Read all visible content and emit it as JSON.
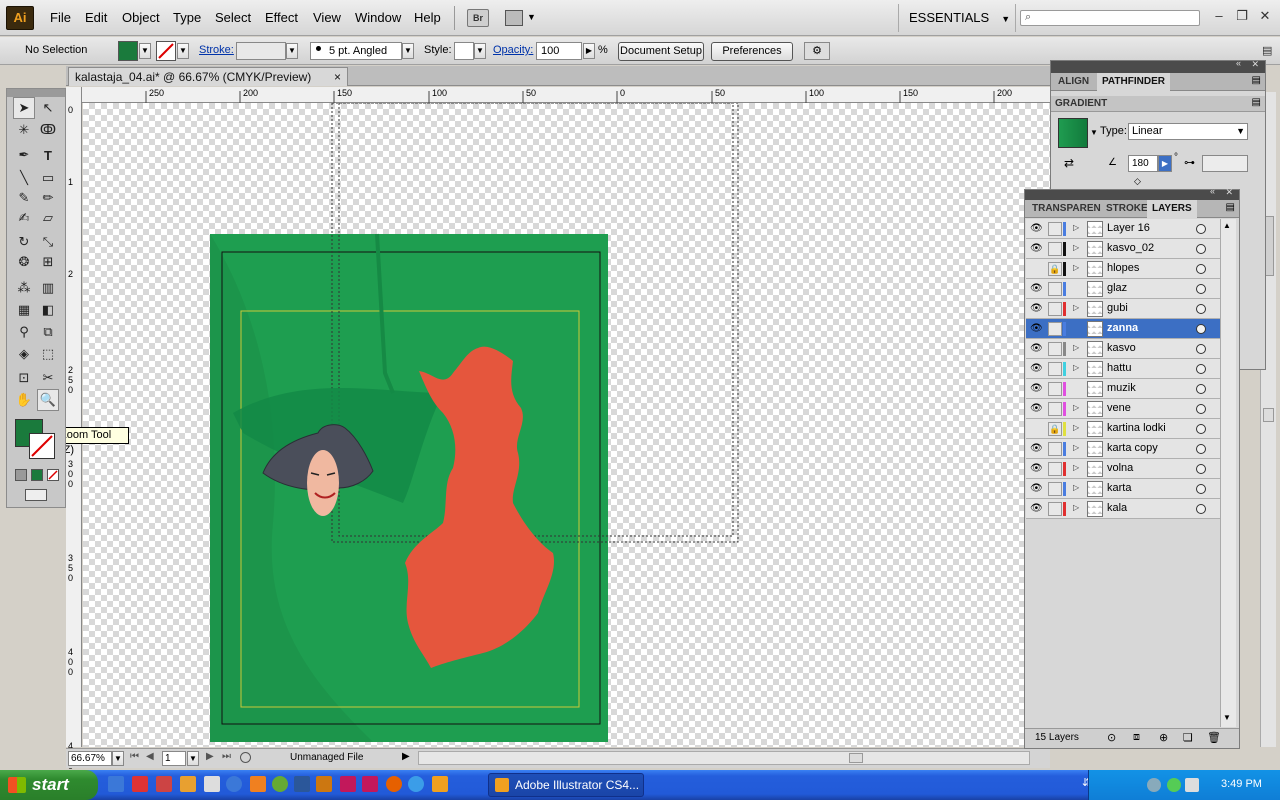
{
  "app": {
    "logo": "Ai",
    "menus": [
      "File",
      "Edit",
      "Object",
      "Type",
      "Select",
      "Effect",
      "View",
      "Window",
      "Help"
    ],
    "bridge": "Br",
    "workspace": "ESSENTIALS"
  },
  "control": {
    "selection": "No Selection",
    "stroke_label": "Stroke:",
    "brush": "5 pt. Angled",
    "style_label": "Style:",
    "opacity_label": "Opacity:",
    "opacity_value": "100",
    "percent": "%",
    "doc_setup": "Document Setup",
    "preferences": "Preferences",
    "fill_color": "#1a7a3c"
  },
  "document": {
    "tab_title": "kalastaja_04.ai* @ 66.67% (CMYK/Preview)",
    "close": "×",
    "zoom": "66.67%",
    "artboard": "1",
    "status": "Unmanaged File"
  },
  "ruler": {
    "h_ticks": [
      "250",
      "200",
      "150",
      "100",
      "50",
      "0",
      "50",
      "100",
      "150",
      "200"
    ],
    "v_ticks": [
      "0",
      "1",
      "2",
      "2",
      "5",
      "0",
      "3",
      "0",
      "0",
      "3",
      "5",
      "0",
      "4",
      "0",
      "0",
      "4",
      "5",
      "0"
    ]
  },
  "tooltip": "Zoom Tool (Z)",
  "panels": {
    "top_tabs": [
      "ALIGN",
      "PATHFINDER"
    ],
    "gradient_title": "GRADIENT",
    "gradient_type_label": "Type:",
    "gradient_type": "Linear",
    "gradient_angle": "180",
    "degree": "°",
    "mid_tabs": [
      "TRANSPAREN",
      "STROKE",
      "LAYERS"
    ],
    "layers_count": "15 Layers"
  },
  "layers": [
    {
      "name": "Layer 16",
      "eye": true,
      "lock": false,
      "color": "#4a7de0",
      "expand": true
    },
    {
      "name": "kasvo_02",
      "eye": true,
      "lock": false,
      "color": "#111111",
      "expand": true
    },
    {
      "name": "hlopes",
      "eye": false,
      "lock": true,
      "color": "#111111",
      "expand": true
    },
    {
      "name": "glaz",
      "eye": true,
      "lock": false,
      "color": "#4a7de0",
      "expand": false
    },
    {
      "name": "gubi",
      "eye": true,
      "lock": false,
      "color": "#e03030",
      "expand": true
    },
    {
      "name": "zanna",
      "eye": true,
      "lock": false,
      "color": "#4a7de0",
      "expand": false,
      "selected": true
    },
    {
      "name": "kasvo",
      "eye": true,
      "lock": false,
      "color": "#888888",
      "expand": true
    },
    {
      "name": "hattu",
      "eye": true,
      "lock": false,
      "color": "#40d0e0",
      "expand": true
    },
    {
      "name": "muzik",
      "eye": true,
      "lock": false,
      "color": "#e050e0",
      "expand": false
    },
    {
      "name": "vene",
      "eye": true,
      "lock": false,
      "color": "#e050e0",
      "expand": true
    },
    {
      "name": "kartina lodki",
      "eye": false,
      "lock": true,
      "color": "#e0e040",
      "expand": true
    },
    {
      "name": "karta copy",
      "eye": true,
      "lock": false,
      "color": "#4a7de0",
      "expand": true
    },
    {
      "name": "volna",
      "eye": true,
      "lock": false,
      "color": "#e03030",
      "expand": true
    },
    {
      "name": "karta",
      "eye": true,
      "lock": false,
      "color": "#4a7de0",
      "expand": true
    },
    {
      "name": "kala",
      "eye": true,
      "lock": false,
      "color": "#e03030",
      "expand": true
    }
  ],
  "taskbar": {
    "start": "start",
    "active_app": "Adobe Illustrator CS4...",
    "clock": "3:49 PM"
  }
}
